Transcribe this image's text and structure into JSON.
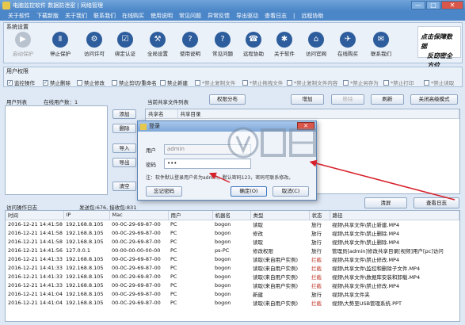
{
  "window": {
    "title": "电脑监控软件 数据防泄密 | 网络管理",
    "minimize": "—",
    "maximize": "□",
    "close": "✕"
  },
  "menu": [
    "关于软件",
    "下载新版",
    "关于我们",
    "联系我们",
    "在线购买",
    "使用说明",
    "常见问题",
    "异常反馈",
    "导出驱动",
    "查看日志",
    "|",
    "远程协助"
  ],
  "system_settings": {
    "label": "系统设置",
    "buttons": [
      {
        "label": "启动保护",
        "icon": "▶",
        "disabled": true
      },
      {
        "label": "停止保护",
        "icon": "Ⅱ",
        "disabled": false
      },
      {
        "label": "访问许可",
        "icon": "⚙",
        "disabled": false
      },
      {
        "label": "绑定认证",
        "icon": "☑",
        "disabled": false
      },
      {
        "label": "全局设置",
        "icon": "⚒",
        "disabled": false
      },
      {
        "label": "使用说明",
        "icon": "?",
        "disabled": false
      },
      {
        "label": "常见问题",
        "icon": "?",
        "disabled": false
      },
      {
        "label": "远程协助",
        "icon": "☎",
        "disabled": false
      },
      {
        "label": "关于软件",
        "icon": "✱",
        "disabled": false
      },
      {
        "label": "访问官网",
        "icon": "⌂",
        "disabled": false
      },
      {
        "label": "在线购买",
        "icon": "✈",
        "disabled": false
      },
      {
        "label": "联系我们",
        "icon": "✉",
        "disabled": false
      }
    ],
    "logo_text": [
      "点击保障数据",
      "反窃密全方位"
    ]
  },
  "permissions": {
    "label": "用户权限",
    "options": [
      {
        "label": "监控操作",
        "checked": true,
        "dim": false
      },
      {
        "label": "禁止删除",
        "checked": true,
        "dim": false
      },
      {
        "label": "禁止修改",
        "checked": false,
        "dim": false
      },
      {
        "label": "禁止剪切/重命名",
        "checked": false,
        "dim": false
      },
      {
        "label": "禁止新建",
        "checked": false,
        "dim": false
      },
      {
        "label": "*禁止复制文件",
        "checked": false,
        "dim": true
      },
      {
        "label": "*禁止拖拽文件",
        "checked": false,
        "dim": true
      },
      {
        "label": "*禁止复制文件内容",
        "checked": false,
        "dim": true
      },
      {
        "label": "*禁止另存为",
        "checked": false,
        "dim": true
      },
      {
        "label": "*禁止打印",
        "checked": false,
        "dim": true
      },
      {
        "label": "*禁止读取",
        "checked": false,
        "dim": true
      }
    ]
  },
  "users": {
    "label": "用户列表",
    "online_label": "在线用户数：1",
    "buttons": {
      "add": "添加",
      "remove": "删除",
      "import": "导入",
      "export": "导出",
      "clear": "清空"
    }
  },
  "shares": {
    "label": "当前共享文件列表",
    "perm_button": "权限分布",
    "add": "增加",
    "remove": "移除",
    "refresh": "刷新",
    "advanced": "关闭高级模式",
    "columns": [
      "共享名",
      "共享目录"
    ],
    "rows": [
      [
        "视频",
        "C:\\视频"
      ]
    ]
  },
  "dialog": {
    "title": "登录",
    "close": "✕",
    "user_label": "用户",
    "user_value": "admin",
    "pass_label": "密码",
    "pass_value": "•••",
    "note": "注：软件默认登录用户名为admin，默认密码123，密码可联系修改。",
    "forgot": "忘记密码",
    "ok": "确定(O)",
    "cancel": "取消(C)"
  },
  "log": {
    "label": "访问操作日志",
    "stats": "发送包:676, 接收包:831",
    "clear": "清屏",
    "view": "查看日志",
    "columns": [
      "时间",
      "IP",
      "Mac",
      "用户",
      "机器名",
      "类型",
      "状态",
      "路径"
    ],
    "rows": [
      [
        "2016-12-21 14:41:58",
        "192.168.8.105",
        "00-0C-29-69-87-00",
        "PC",
        "bogon",
        "读取",
        "放行",
        "视频\\共享文件\\禁止新建.MP4"
      ],
      [
        "2016-12-21 14:41:58",
        "192.168.8.105",
        "00-0C-29-69-87-00",
        "PC",
        "bogon",
        "修改",
        "放行",
        "视频\\共享文件\\禁止删除.MP4"
      ],
      [
        "2016-12-21 14:41:58",
        "192.168.8.105",
        "00-0C-29-69-87-00",
        "PC",
        "bogon",
        "读取",
        "放行",
        "视频\\共享文件\\禁止删除.MP4"
      ],
      [
        "2016-12-21 14:41:56",
        "127.0.0.1",
        "00-00-00-00-00-00",
        "PC",
        "ps-PC",
        "修改权限",
        "放行",
        "管理员[admin]修改共享目录[视频]用户[pc]访问"
      ],
      [
        "2016-12-21 14:41:33",
        "192.168.8.105",
        "00-0C-29-69-87-00",
        "PC",
        "bogon",
        "读取(来自用户实例)",
        "拦截",
        "视频\\共享文件\\禁止修改.MP4"
      ],
      [
        "2016-12-21 14:41:33",
        "192.168.8.105",
        "00-0C-29-69-87-00",
        "PC",
        "bogon",
        "读取(来自用户实例)",
        "拦截",
        "视频\\共享文件\\监控和删除子文件.MP4"
      ],
      [
        "2016-12-21 14:41:33",
        "192.168.8.105",
        "00-0C-29-69-87-00",
        "PC",
        "bogon",
        "读取(来自用户实例)",
        "拦截",
        "视频\\共享文件\\数据库安装和卸载.MP4"
      ],
      [
        "2016-12-21 14:41:33",
        "192.168.8.105",
        "00-0C-29-69-87-00",
        "PC",
        "bogon",
        "读取(来自用户实例)",
        "拦截",
        "视频\\共享文件\\禁止修改.MP4"
      ],
      [
        "2016-12-21 14:41:04",
        "192.168.8.105",
        "00-0C-29-69-87-00",
        "PC",
        "bogon",
        "新建",
        "放行",
        "视频\\共享文件夹"
      ],
      [
        "2016-12-21 14:41:04",
        "192.168.8.105",
        "00-0C-29-69-87-00",
        "PC",
        "bogon",
        "读取(来自用户实例)",
        "拦截",
        "视频\\大势至USB管理系统.PPT"
      ]
    ]
  },
  "colors": {
    "accent": "#4b86c8",
    "arrow": "#d8202a",
    "block": "#c23b2e"
  }
}
